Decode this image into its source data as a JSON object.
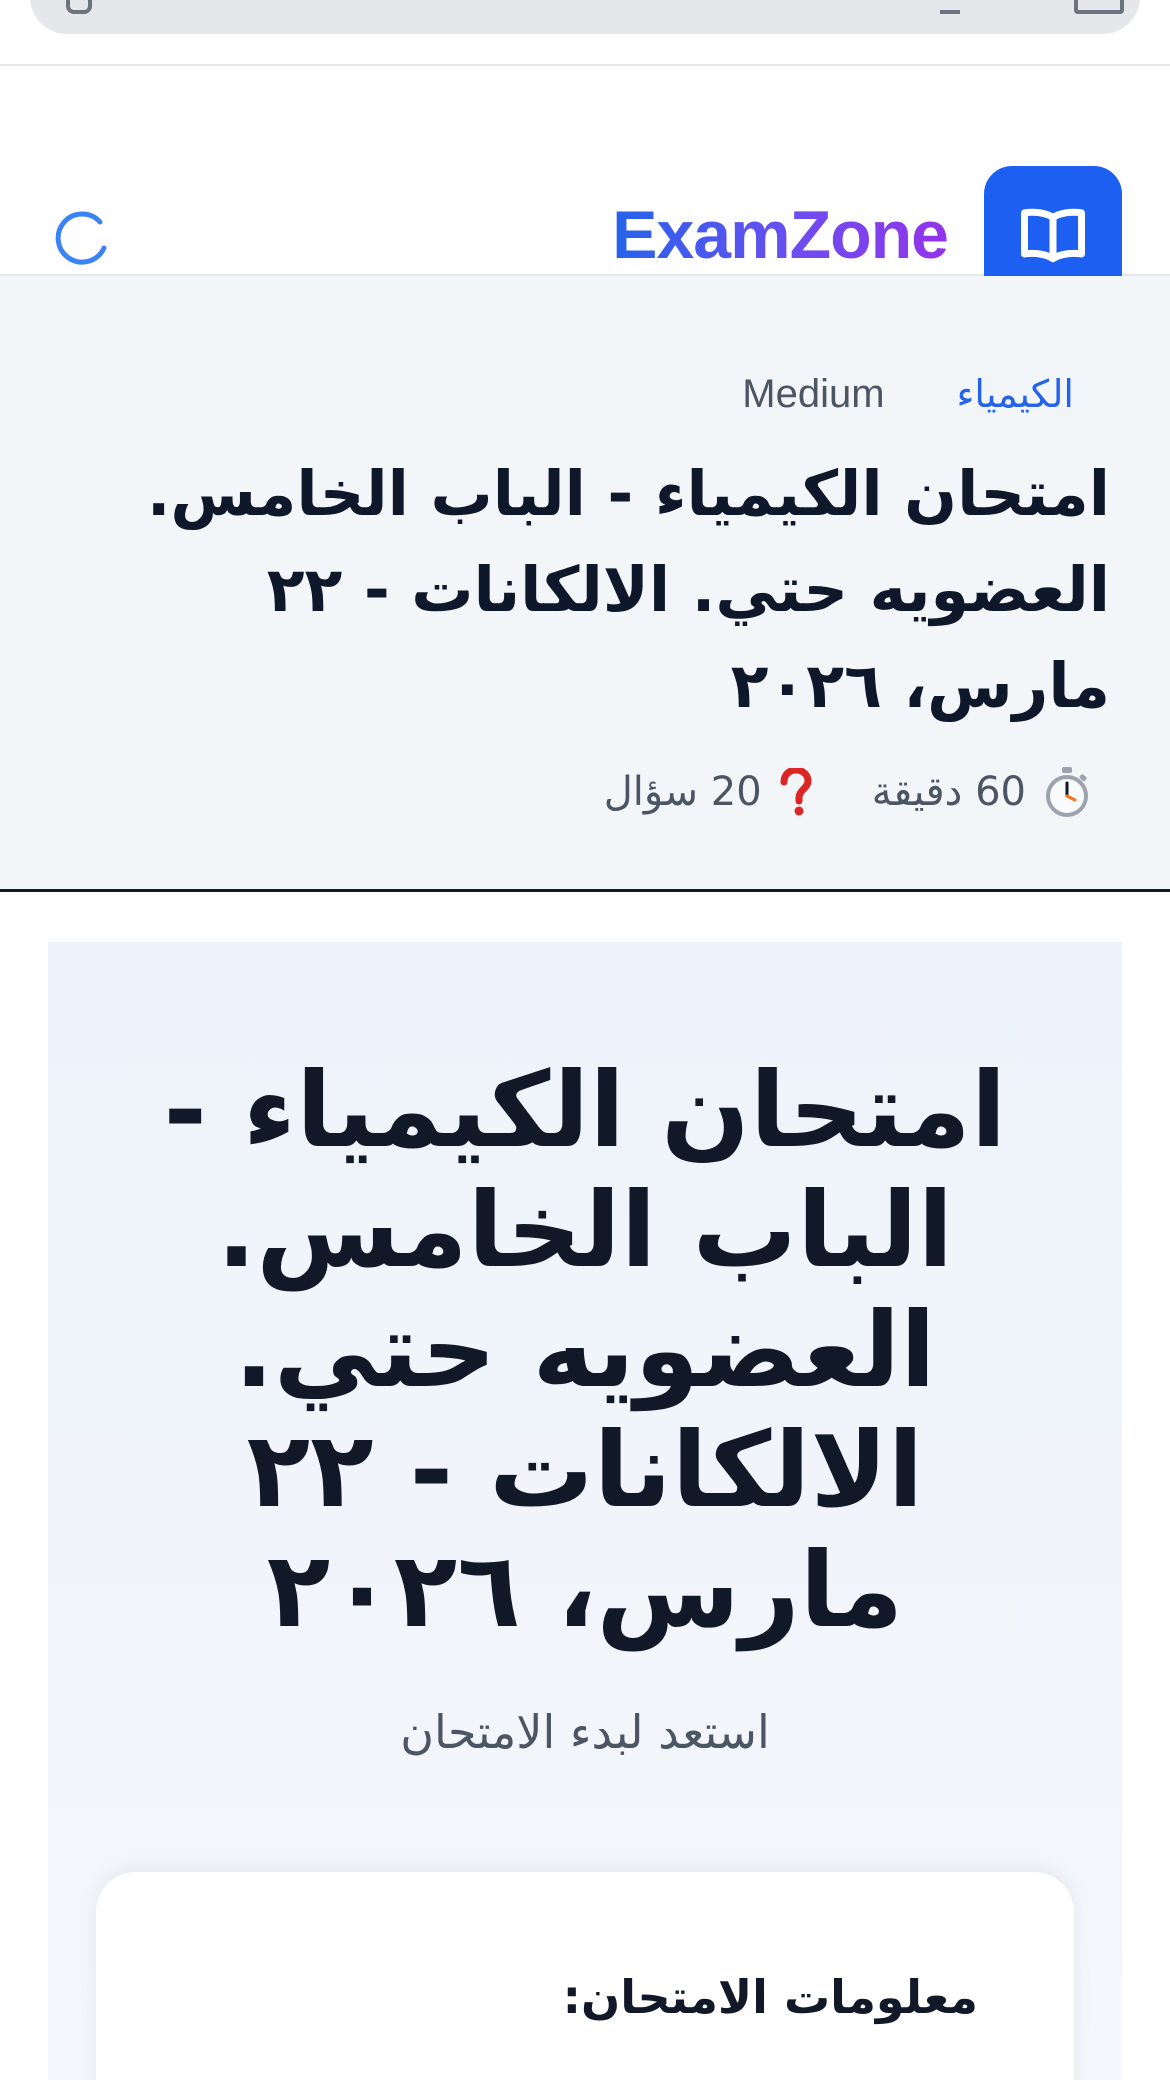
{
  "app": {
    "brand": "ExamZone"
  },
  "icons": {
    "loader": "loading-spinner-icon",
    "logo": "open-book-icon",
    "timer": "stopwatch-icon",
    "questions": "question-mark-icon"
  },
  "colors": {
    "accent": "#1d5ff0",
    "brand_gradient_start": "#2563eb",
    "brand_gradient_end": "#9333ea",
    "subject_link": "#2563eb",
    "question_icon": "#dc2626"
  },
  "summary": {
    "subject": "الكيمياء",
    "level": "Medium",
    "title": "امتحان الكيمياء - الباب الخامس. العضويه حتي. الالكانات - ٢٢ مارس، ٢٠٢٦",
    "duration": "60 دقيقة",
    "questions": "20 سؤال"
  },
  "start": {
    "title": "امتحان الكيمياء - الباب الخامس. العضويه حتي. الالكانات - ٢٢ مارس، ٢٠٢٦",
    "subtitle": "استعد لبدء الامتحان",
    "info_title": "معلومات الامتحان:"
  }
}
